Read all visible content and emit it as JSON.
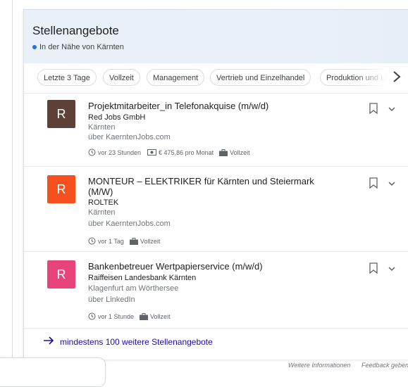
{
  "header": {
    "title": "Stellenangebote",
    "subtitle": "In der Nähe von Kärnten"
  },
  "chips": [
    {
      "label": "Letzte 3 Tage"
    },
    {
      "label": "Vollzeit"
    },
    {
      "label": "Management"
    },
    {
      "label": "Vertrieb und Einzelhandel"
    },
    {
      "label": "Produktion und La"
    }
  ],
  "jobs": [
    {
      "logo_letter": "R",
      "logo_color": "#5d4037",
      "title": "Projektmitarbeiter_in Telefonakquise (m/w/d)",
      "company": "Red Jobs GmbH",
      "location": "Kärnten",
      "source": "über KaerntenJobs.com",
      "posted": "vor 23 Stunden",
      "salary": "€ 475,86 pro Monat",
      "type": "Vollzeit"
    },
    {
      "logo_letter": "R",
      "logo_color": "#f4511e",
      "title_line1": "MONTEUR – ELEKTRIKER für Kärnten und Steiermark",
      "title_line2": "(M/W)",
      "company": "ROLTEK",
      "location": "Kärnten",
      "source": "über KaerntenJobs.com",
      "posted": "vor 1 Tag",
      "type": "Vollzeit"
    },
    {
      "logo_letter": "R",
      "logo_color": "#e8437a",
      "title": "Bankenbetreuer Wertpapierservice (m/w/d)",
      "company": "Raiffeisen Landesbank Kärnten",
      "location": "Klagenfurt am Wörthersee",
      "source": "über LinkedIn",
      "posted": "vor 1 Stunde",
      "type": "Vollzeit"
    }
  ],
  "more_link": "mindestens 100 weitere Stellenangebote",
  "footer": {
    "info": "Weitere Informationen",
    "feedback": "Feedback geben"
  },
  "icons": {
    "location_dot": "dot-icon",
    "next": "chevron-right-icon",
    "bookmark": "bookmark-icon",
    "expand": "chevron-down-icon",
    "clock": "clock-icon",
    "money": "money-icon",
    "briefcase": "briefcase-icon",
    "more_arrow": "arrow-right-icon"
  },
  "colors": {
    "link": "#1a0dab",
    "accent": "#1a73e8"
  }
}
